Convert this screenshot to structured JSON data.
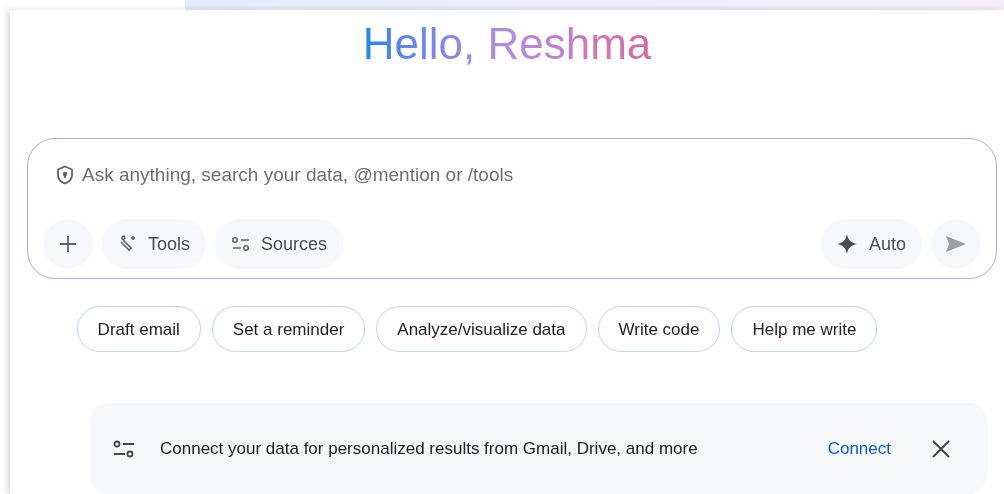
{
  "greeting": "Hello, Reshma",
  "prompt": {
    "placeholder": "Ask anything, search your data, @mention or /tools"
  },
  "toolbar": {
    "tools_label": "Tools",
    "sources_label": "Sources",
    "mode_label": "Auto"
  },
  "suggestions": [
    "Draft email",
    "Set a reminder",
    "Analyze/visualize data",
    "Write code",
    "Help me write"
  ],
  "banner": {
    "text": "Connect your data for personalized results from Gmail, Drive, and more",
    "action": "Connect"
  }
}
